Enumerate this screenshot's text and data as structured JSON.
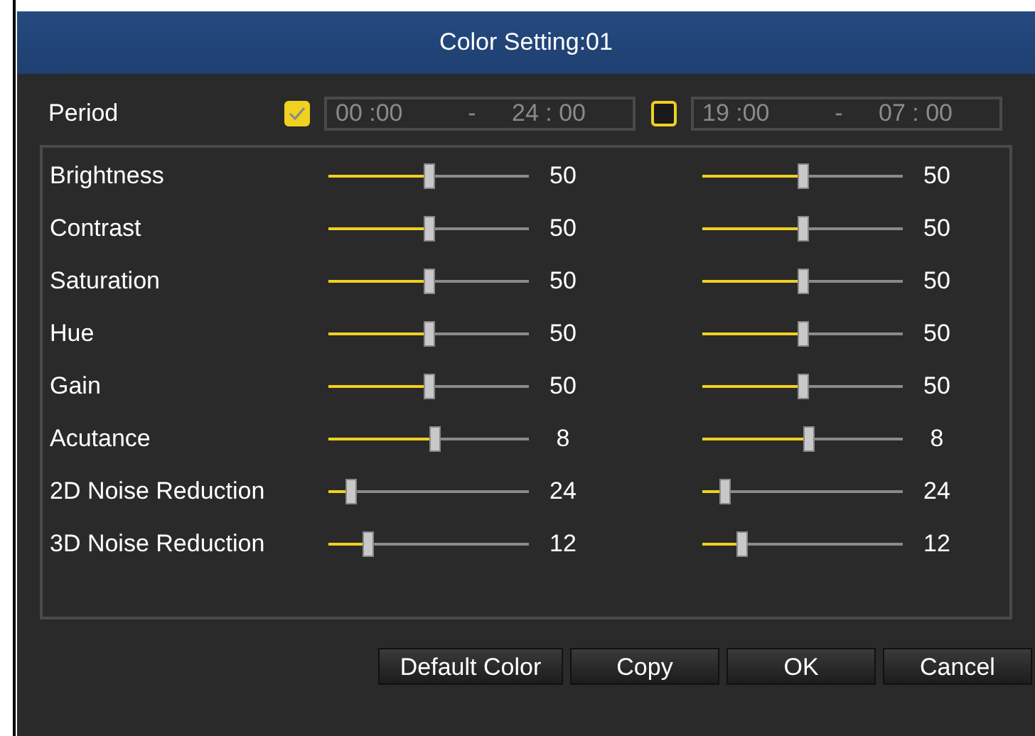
{
  "dialog": {
    "title": "Color Setting:01"
  },
  "period": {
    "label": "Period",
    "ranges": [
      {
        "checked": true,
        "start": "00 :00",
        "separator": "-",
        "end": "24 : 00"
      },
      {
        "checked": false,
        "start": "19 :00",
        "separator": "-",
        "end": "07 : 00"
      }
    ]
  },
  "settings": [
    {
      "name": "Brightness",
      "columns": [
        {
          "level": 0.5,
          "value": "50"
        },
        {
          "level": 0.5,
          "value": "50"
        }
      ]
    },
    {
      "name": "Contrast",
      "columns": [
        {
          "level": 0.5,
          "value": "50"
        },
        {
          "level": 0.5,
          "value": "50"
        }
      ]
    },
    {
      "name": "Saturation",
      "columns": [
        {
          "level": 0.5,
          "value": "50"
        },
        {
          "level": 0.5,
          "value": "50"
        }
      ]
    },
    {
      "name": "Hue",
      "columns": [
        {
          "level": 0.5,
          "value": "50"
        },
        {
          "level": 0.5,
          "value": "50"
        }
      ]
    },
    {
      "name": "Gain",
      "columns": [
        {
          "level": 0.5,
          "value": "50"
        },
        {
          "level": 0.5,
          "value": "50"
        }
      ]
    },
    {
      "name": "Acutance",
      "columns": [
        {
          "level": 0.53,
          "value": "8"
        },
        {
          "level": 0.53,
          "value": "8"
        }
      ]
    },
    {
      "name": "2D Noise Reduction",
      "columns": [
        {
          "level": 0.11,
          "value": "24"
        },
        {
          "level": 0.11,
          "value": "24"
        }
      ]
    },
    {
      "name": "3D Noise Reduction",
      "columns": [
        {
          "level": 0.2,
          "value": "12"
        },
        {
          "level": 0.2,
          "value": "12"
        }
      ]
    }
  ],
  "buttons": [
    "Default Color",
    "Copy",
    "OK",
    "Cancel"
  ]
}
